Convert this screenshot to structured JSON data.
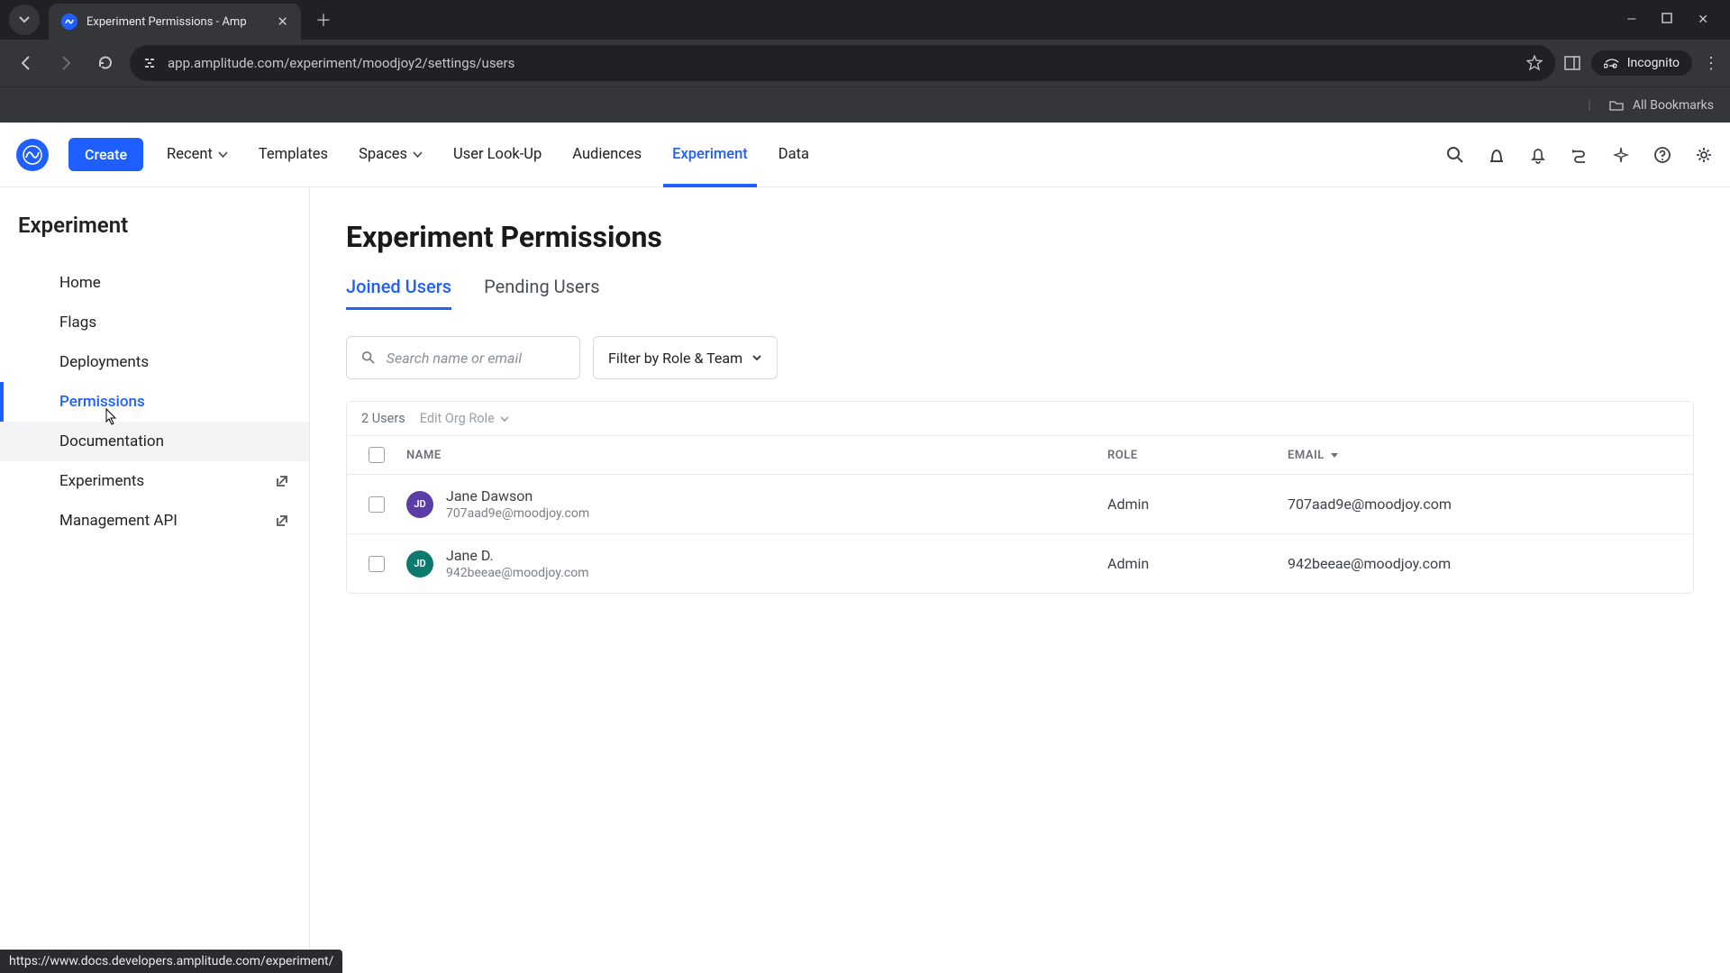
{
  "browser": {
    "tab_title": "Experiment Permissions - Amp",
    "url": "app.amplitude.com/experiment/moodjoy2/settings/users",
    "incognito_label": "Incognito",
    "all_bookmarks": "All Bookmarks",
    "status_url": "https://www.docs.developers.amplitude.com/experiment/"
  },
  "header": {
    "create": "Create",
    "nav": [
      "Recent",
      "Templates",
      "Spaces",
      "User Look-Up",
      "Audiences",
      "Experiment",
      "Data"
    ],
    "active_index": 5,
    "dropdown_indices": [
      0,
      2
    ]
  },
  "sidebar": {
    "title": "Experiment",
    "items": [
      {
        "label": "Home",
        "ext": false
      },
      {
        "label": "Flags",
        "ext": false
      },
      {
        "label": "Deployments",
        "ext": false
      },
      {
        "label": "Permissions",
        "ext": false
      },
      {
        "label": "Documentation",
        "ext": false
      },
      {
        "label": "Experiments",
        "ext": true
      },
      {
        "label": "Management API",
        "ext": true
      }
    ],
    "active_index": 3,
    "hover_index": 4
  },
  "main": {
    "title": "Experiment Permissions",
    "tabs": [
      "Joined Users",
      "Pending Users"
    ],
    "active_tab": 0,
    "search_placeholder": "Search name or email",
    "filter_label": "Filter by Role & Team",
    "user_count": "2 Users",
    "edit_role": "Edit Org Role",
    "columns": {
      "name": "NAME",
      "role": "ROLE",
      "email": "EMAIL"
    },
    "rows": [
      {
        "initials": "JD",
        "avatar_color": "#5b3ea5",
        "name": "Jane Dawson",
        "sub": "707aad9e@moodjoy.com",
        "role": "Admin",
        "email": "707aad9e@moodjoy.com"
      },
      {
        "initials": "JD",
        "avatar_color": "#0d7a6e",
        "name": "Jane D.",
        "sub": "942beeae@moodjoy.com",
        "role": "Admin",
        "email": "942beeae@moodjoy.com"
      }
    ]
  }
}
